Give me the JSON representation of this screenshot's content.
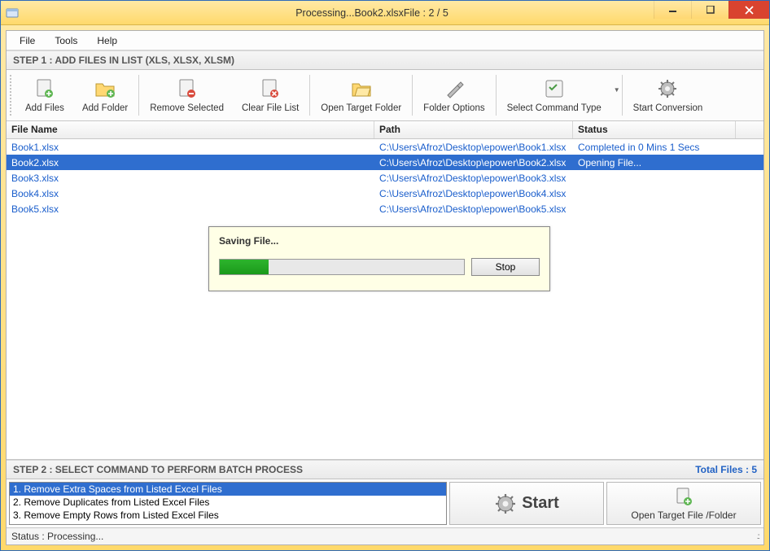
{
  "window": {
    "title": "Processing...Book2.xlsxFile : 2 / 5"
  },
  "menu": {
    "file": "File",
    "tools": "Tools",
    "help": "Help"
  },
  "step1": {
    "header": "STEP 1 : ADD FILES IN LIST (XLS, XLSX, XLSM)"
  },
  "toolbar": {
    "add_files": "Add Files",
    "add_folder": "Add Folder",
    "remove_selected": "Remove Selected",
    "clear_file_list": "Clear File List",
    "open_target_folder": "Open Target Folder",
    "folder_options": "Folder Options",
    "select_command_type": "Select Command Type",
    "start_conversion": "Start Conversion"
  },
  "grid": {
    "headers": {
      "file_name": "File Name",
      "path": "Path",
      "status": "Status"
    },
    "rows": [
      {
        "name": "Book1.xlsx",
        "path": "C:\\Users\\Afroz\\Desktop\\epower\\Book1.xlsx",
        "status": "Completed in 0 Mins 1 Secs",
        "selected": false
      },
      {
        "name": "Book2.xlsx",
        "path": "C:\\Users\\Afroz\\Desktop\\epower\\Book2.xlsx",
        "status": "Opening File...",
        "selected": true
      },
      {
        "name": "Book3.xlsx",
        "path": "C:\\Users\\Afroz\\Desktop\\epower\\Book3.xlsx",
        "status": "",
        "selected": false
      },
      {
        "name": "Book4.xlsx",
        "path": "C:\\Users\\Afroz\\Desktop\\epower\\Book4.xlsx",
        "status": "",
        "selected": false
      },
      {
        "name": "Book5.xlsx",
        "path": "C:\\Users\\Afroz\\Desktop\\epower\\Book5.xlsx",
        "status": "",
        "selected": false
      }
    ]
  },
  "progress": {
    "label": "Saving File...",
    "percent": 20,
    "stop": "Stop"
  },
  "step2": {
    "header": "STEP 2 : SELECT COMMAND TO PERFORM BATCH PROCESS",
    "total_files_label": "Total Files : 5",
    "commands": [
      {
        "text": "1. Remove Extra Spaces from Listed Excel Files",
        "selected": true
      },
      {
        "text": "2. Remove Duplicates from Listed Excel Files",
        "selected": false
      },
      {
        "text": "3. Remove Empty Rows from Listed Excel Files",
        "selected": false
      }
    ],
    "start": "Start",
    "open_target": "Open Target File /Folder"
  },
  "statusbar": {
    "text": "Status  :  Processing..."
  }
}
